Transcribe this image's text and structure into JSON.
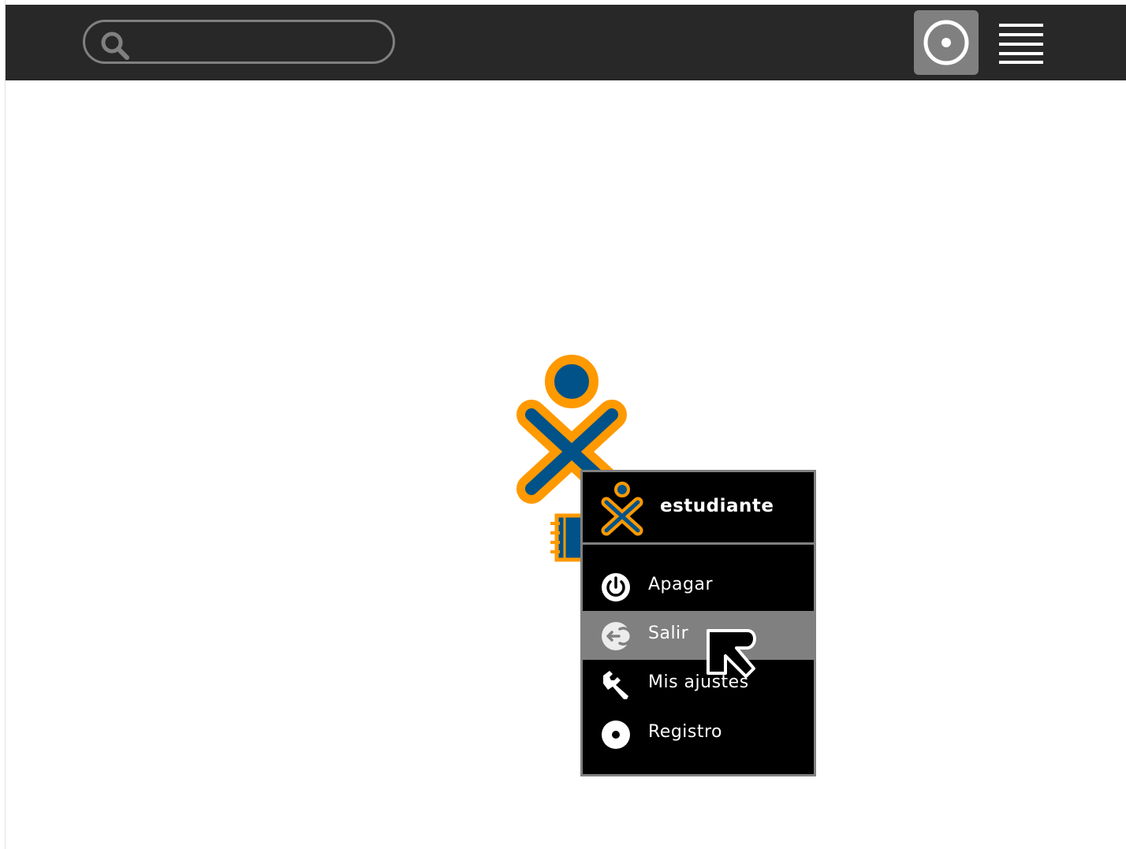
{
  "toolbar": {
    "search": {
      "placeholder": "",
      "value": ""
    },
    "icons": {
      "search": "search-icon",
      "home_view": "home-view-icon",
      "list_view": "list-view-icon"
    },
    "background_color": "#282828",
    "selected_button_color": "#808080"
  },
  "desktop": {
    "background_color": "#ffffff",
    "xo_icon": "xo-buddy-icon",
    "journal_icon": "journal-icon",
    "xo_colors": {
      "stroke": "#ff9900",
      "fill": "#005288"
    }
  },
  "palette": {
    "title": "estudiante",
    "items": [
      {
        "label": "Apagar",
        "icon": "power-icon",
        "highlighted": false
      },
      {
        "label": "Salir",
        "icon": "logout-icon",
        "highlighted": true
      },
      {
        "label": "Mis ajustes",
        "icon": "wrench-icon",
        "highlighted": false
      },
      {
        "label": "Registro",
        "icon": "record-icon",
        "highlighted": false
      }
    ],
    "background_color": "#000000",
    "highlight_color": "#808080"
  }
}
